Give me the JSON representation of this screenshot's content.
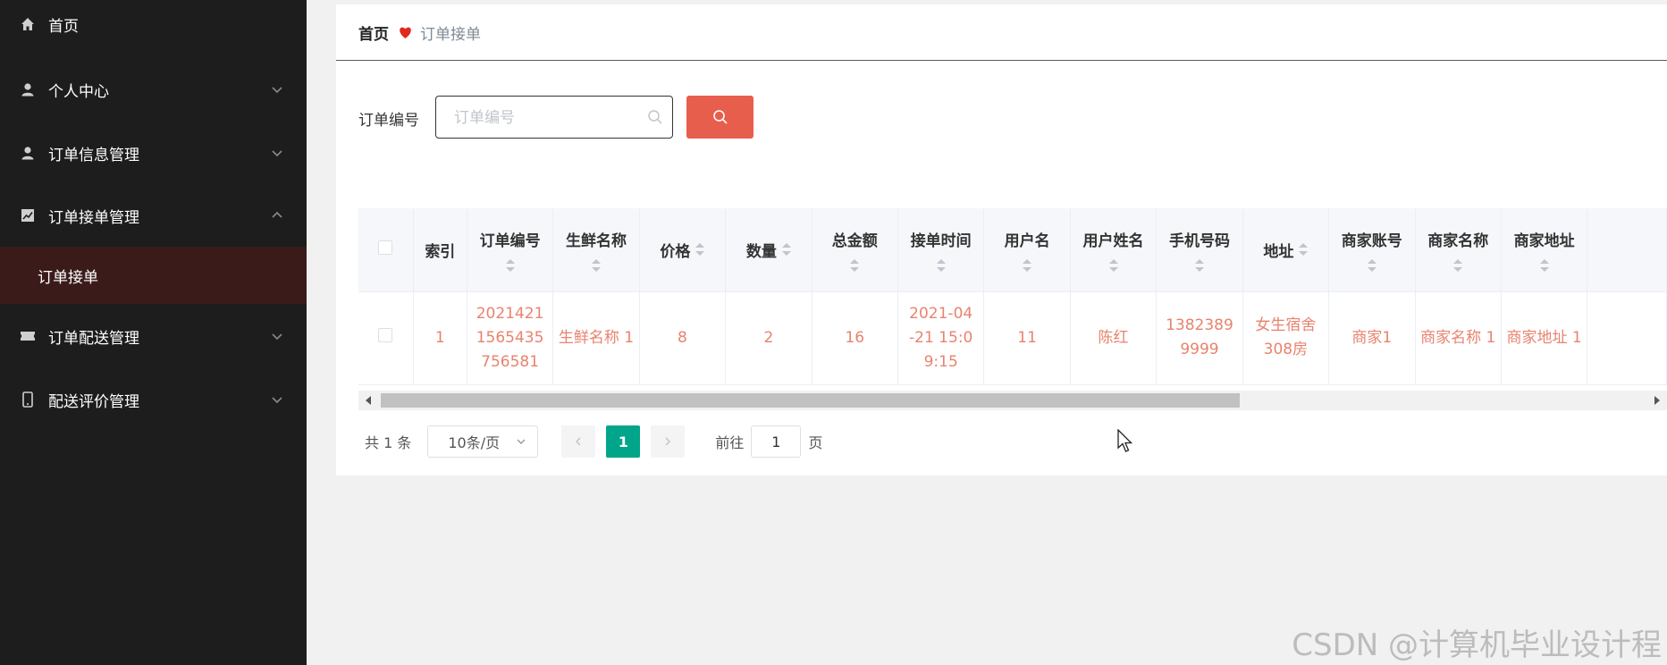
{
  "sidebar": {
    "items": [
      {
        "label": "首页",
        "icon": "home-icon"
      },
      {
        "label": "个人中心",
        "icon": "user-icon"
      },
      {
        "label": "订单信息管理",
        "icon": "user-icon"
      },
      {
        "label": "订单接单管理",
        "icon": "chart-icon"
      },
      {
        "label": "订单配送管理",
        "icon": "ticket-icon"
      },
      {
        "label": "配送评价管理",
        "icon": "phone-icon"
      }
    ],
    "active_sub": "订单接单"
  },
  "breadcrumb": {
    "home": "首页",
    "current": "订单接单"
  },
  "search": {
    "label": "订单编号",
    "placeholder": "订单编号",
    "value": ""
  },
  "table": {
    "headers": [
      "索引",
      "订单编号",
      "生鲜名称",
      "价格",
      "数量",
      "总金额",
      "接单时间",
      "用户名",
      "用户姓名",
      "手机号码",
      "地址",
      "商家账号",
      "商家名称",
      "商家地址"
    ],
    "rows": [
      {
        "index": "1",
        "order_no": "2021421 1565435 756581",
        "product": "生鲜名称 1",
        "price": "8",
        "qty": "2",
        "total": "16",
        "time": "2021-04 -21 15:0 9:15",
        "username": "11",
        "name": "陈红",
        "phone": "1382389 9999",
        "address": "女生宿舍 308房",
        "merchant_account": "商家1",
        "merchant_name": "商家名称 1",
        "merchant_address": "商家地址 1"
      }
    ]
  },
  "pagination": {
    "total": "共 1 条",
    "page_size": "10条/页",
    "current_page": "1",
    "goto_prefix": "前往",
    "goto_value": "1",
    "goto_suffix": "页"
  },
  "watermark": "CSDN @计算机毕业设计程",
  "colors": {
    "sidebar_bg": "#1d1d1d",
    "sidebar_active_bg": "#3a1b1a",
    "accent_red": "#e85e4d",
    "link_text": "#e8836e",
    "page_active": "#00a58a"
  }
}
